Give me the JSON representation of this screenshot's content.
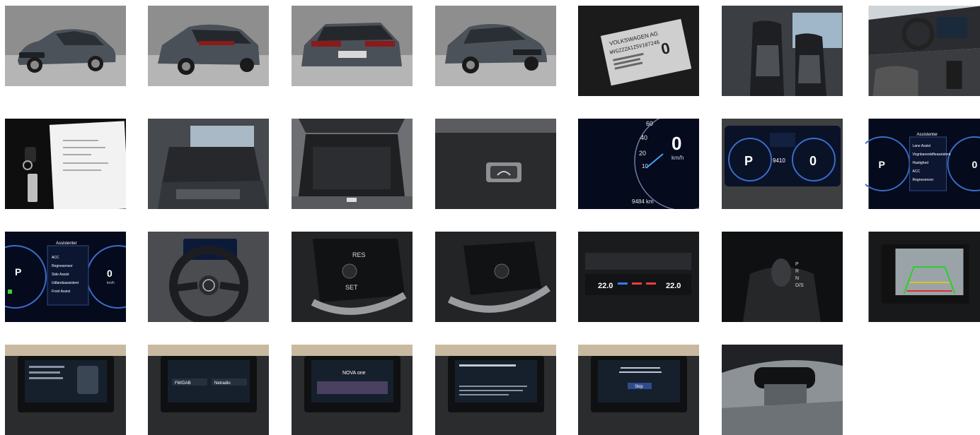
{
  "gallery": {
    "photos": [
      {
        "subject": "car-front-left-exterior"
      },
      {
        "subject": "car-rear-left-exterior"
      },
      {
        "subject": "car-rear-exterior"
      },
      {
        "subject": "car-front-right-exterior"
      },
      {
        "subject": "vin-plate",
        "text": {
          "line1": "VOLKSWAGEN AG",
          "line2": "WVGZZZA1ZSV107246",
          "value": "0"
        }
      },
      {
        "subject": "front-seats"
      },
      {
        "subject": "dashboard-interior"
      },
      {
        "subject": "keys-and-documents"
      },
      {
        "subject": "rear-seats"
      },
      {
        "subject": "open-trunk"
      },
      {
        "subject": "trunk-release-button"
      },
      {
        "subject": "instrument-cluster-speed",
        "text": {
          "speed": "0",
          "unit": "km/h",
          "odometer": "9484 km",
          "ticks": [
            "60",
            "40",
            "20",
            "10"
          ]
        }
      },
      {
        "subject": "instrument-cluster-overview",
        "text": {
          "gear": "P",
          "speed": "0",
          "odometer": "9410"
        }
      },
      {
        "subject": "instrument-cluster-assistant-menu",
        "text": {
          "header": "Assistenter",
          "gear": "P",
          "speed": "0",
          "items": [
            "Lane Assist",
            "Vognbaneskifteassistent",
            "Hastighed",
            "ACC",
            "Regnesensor"
          ]
        }
      },
      {
        "subject": "instrument-cluster-assistant-menu-2",
        "text": {
          "header": "Assistenter",
          "gear": "P",
          "speed": "0",
          "unit": "km/h",
          "items": [
            "ACC",
            "Regnesensor",
            "Side Assist",
            "Udlandsassistent",
            "Front Assist"
          ]
        }
      },
      {
        "subject": "steering-wheel"
      },
      {
        "subject": "steering-wheel-left-buttons",
        "text": {
          "res": "RES",
          "set": "SET"
        }
      },
      {
        "subject": "steering-wheel-right-buttons"
      },
      {
        "subject": "climate-control-panel",
        "text": {
          "left_temp": "22.0",
          "right_temp": "22.0"
        }
      },
      {
        "subject": "gear-shifter",
        "text": {
          "gears": [
            "P",
            "R",
            "N",
            "D/S"
          ]
        }
      },
      {
        "subject": "reversing-camera-display"
      },
      {
        "subject": "infotainment-phone-screen"
      },
      {
        "subject": "infotainment-media-screen",
        "text": {
          "item_1": "FM/DAB",
          "item_2": "Netradio"
        }
      },
      {
        "subject": "infotainment-radio-screen",
        "text": {
          "station": "NOVA one"
        }
      },
      {
        "subject": "infotainment-app-connect-screen"
      },
      {
        "subject": "infotainment-navigation-message",
        "text": {
          "button": "Skip"
        }
      },
      {
        "subject": "rear-view-mirror"
      }
    ]
  }
}
